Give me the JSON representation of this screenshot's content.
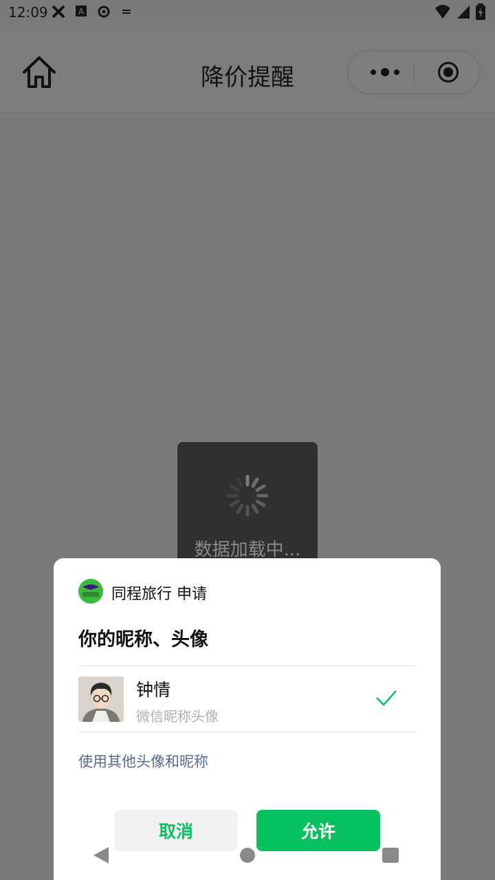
{
  "status_bar": {
    "time": "12:09",
    "left_icons": [
      "cross-icon",
      "text-a-icon",
      "gear-icon",
      "notification-icon"
    ],
    "right_icons": [
      "wifi-icon",
      "signal-icon",
      "battery-charging-icon"
    ]
  },
  "header": {
    "title": "降价提醒",
    "home_icon": "home-icon",
    "more_icon": "more-dots-icon",
    "close_icon": "target-close-icon"
  },
  "loading": {
    "text": "数据加载中..."
  },
  "dialog": {
    "app_name": "同程旅行 申请",
    "title": "你的昵称、头像",
    "user": {
      "nickname": "钟情",
      "subtitle": "微信昵称头像"
    },
    "other_link": "使用其他头像和昵称",
    "cancel_label": "取消",
    "allow_label": "允许",
    "accent_color": "#07c160",
    "link_color": "#576b95"
  },
  "nav": {
    "back_icon": "back-triangle-icon",
    "home_icon": "home-circle-icon",
    "recent_icon": "recent-square-icon"
  }
}
